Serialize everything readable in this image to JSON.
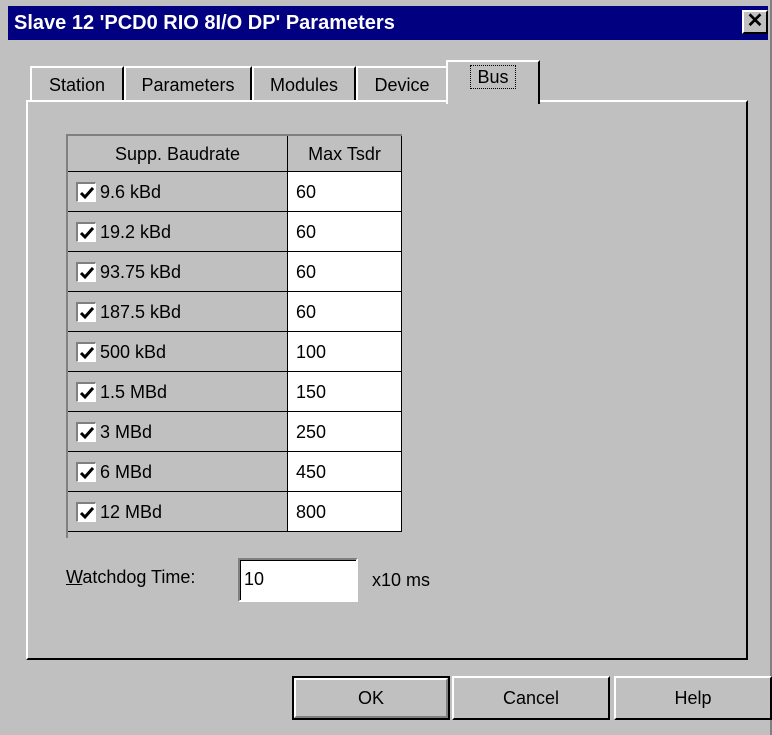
{
  "window": {
    "title": "Slave 12 'PCD0 RIO 8I/O DP' Parameters",
    "close_glyph": "✕"
  },
  "tabs": [
    {
      "label": "Station"
    },
    {
      "label": "Parameters"
    },
    {
      "label": "Modules"
    },
    {
      "label": "Device"
    },
    {
      "label": "Bus",
      "active": true
    }
  ],
  "baud_table": {
    "headers": [
      "Supp. Baudrate",
      "Max Tsdr"
    ],
    "rows": [
      {
        "baudrate": "9.6 kBd",
        "checked": true,
        "max_tsdr": "60"
      },
      {
        "baudrate": "19.2 kBd",
        "checked": true,
        "max_tsdr": "60"
      },
      {
        "baudrate": "93.75 kBd",
        "checked": true,
        "max_tsdr": "60"
      },
      {
        "baudrate": "187.5 kBd",
        "checked": true,
        "max_tsdr": "60"
      },
      {
        "baudrate": "500 kBd",
        "checked": true,
        "max_tsdr": "100"
      },
      {
        "baudrate": "1.5 MBd",
        "checked": true,
        "max_tsdr": "150"
      },
      {
        "baudrate": "3 MBd",
        "checked": true,
        "max_tsdr": "250"
      },
      {
        "baudrate": "6 MBd",
        "checked": true,
        "max_tsdr": "450"
      },
      {
        "baudrate": "12 MBd",
        "checked": true,
        "max_tsdr": "800"
      }
    ]
  },
  "watchdog": {
    "label_accel": "W",
    "label_rest": "atchdog Time:",
    "value": "10",
    "unit": "x10 ms"
  },
  "buttons": {
    "ok": "OK",
    "cancel": "Cancel",
    "help": "Help"
  },
  "colors": {
    "titlebar": "#000080",
    "face": "#c0c0c0"
  }
}
